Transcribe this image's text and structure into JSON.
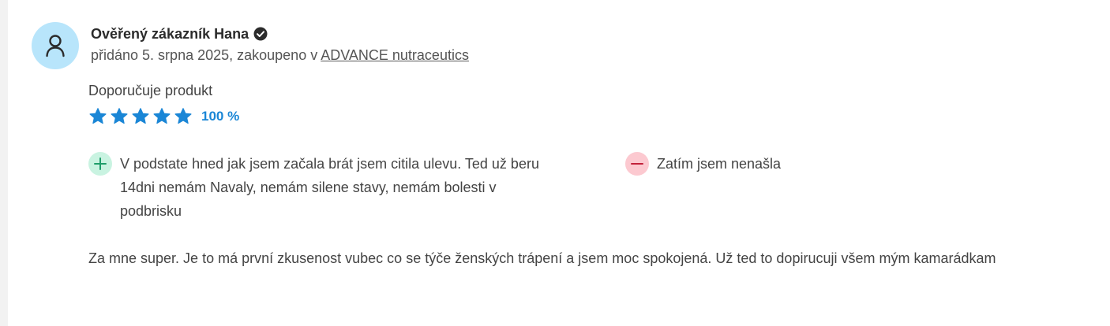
{
  "review": {
    "author": "Ověřený zákazník Hana",
    "verified_icon": "verified-check-icon",
    "meta_prefix": "přidáno 5. srpna 2025, zakoupeno v ",
    "shop_link": "ADVANCE nutraceutics",
    "recommends": "Doporučuje produkt",
    "rating": {
      "stars": 5,
      "max": 5,
      "percent_label": "100 %"
    },
    "pros": "V podstate hned jak jsem začala brát jsem citila ulevu. Ted už beru 14dni nemám Navaly, nemám silene stavy, nemám bolesti v podbrisku",
    "cons": "Zatím jsem nenašla",
    "text": "Za mne super. Je to má první zkusenost vubec co se týče ženských trápení a jsem moc spokojená. Už ted to dopirucuji všem mým kamarádkam"
  },
  "colors": {
    "avatar_bg": "#b8e5fb",
    "star": "#1a86d6",
    "plus_bg": "#c9f3e1",
    "plus_icon": "#1f9d6a",
    "minus_bg": "#fcc9d0",
    "minus_icon": "#c2213a"
  }
}
